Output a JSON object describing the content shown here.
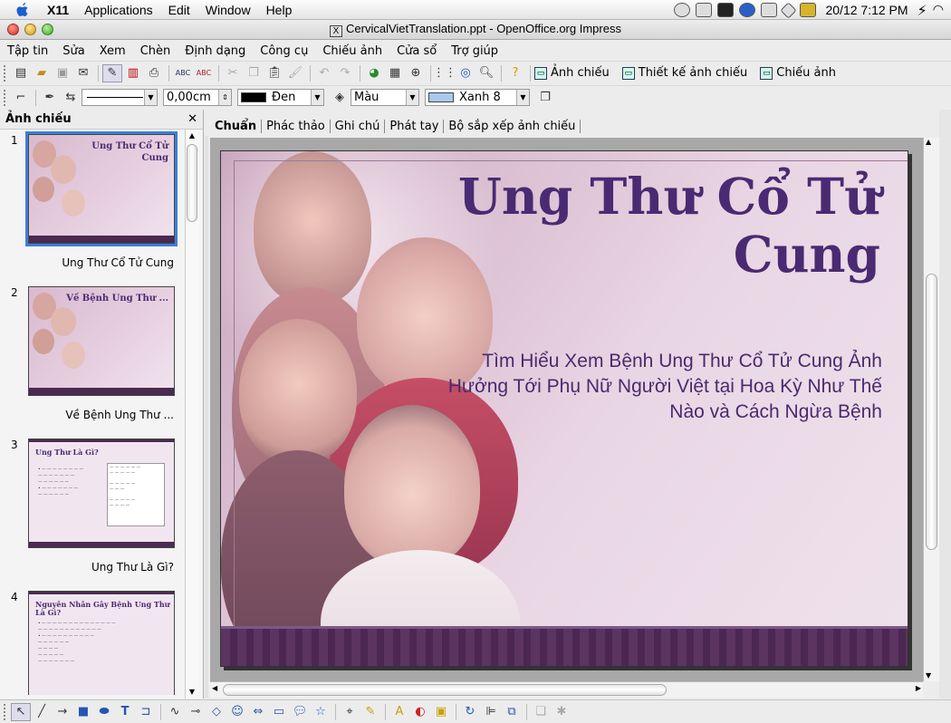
{
  "mac_menubar": {
    "app_name": "X11",
    "menus": [
      "Applications",
      "Edit",
      "Window",
      "Help"
    ],
    "clock": "20/12  7:12 PM"
  },
  "window": {
    "title": "CervicalVietTranslation.ppt - OpenOffice.org Impress"
  },
  "menubar": [
    "Tập tin",
    "Sửa",
    "Xem",
    "Chèn",
    "Định dạng",
    "Công cụ",
    "Chiếu ảnh",
    "Cửa sổ",
    "Trợ giúp"
  ],
  "toolbar1": {
    "slide_show_label": "Ảnh chiếu",
    "slide_design_label": "Thiết kế ảnh chiếu",
    "presentation_label": "Chiếu ảnh"
  },
  "toolbar2": {
    "line_width": "0,00cm",
    "line_color": "Đen",
    "area_style": "Màu",
    "area_color": "Xanh 8"
  },
  "slide_panel": {
    "title": "Ảnh chiếu",
    "slides": [
      {
        "num": "1",
        "caption": "Ung Thư Cổ Tử Cung"
      },
      {
        "num": "2",
        "caption": "Về Bệnh Ung Thư ..."
      },
      {
        "num": "3",
        "caption": "Ung Thư Là Gì?"
      },
      {
        "num": "4",
        "caption": ""
      }
    ],
    "thumb1": {
      "title": "Ung Thư Cổ Tử Cung"
    },
    "thumb2": {
      "title": "Về Bệnh Ung Thư ..."
    },
    "thumb3": {
      "title": "Ung Thư Là Gì?"
    },
    "thumb4": {
      "title": "Nguyên Nhân Gây Bệnh Ung Thư Là Gì?"
    }
  },
  "view_tabs": [
    "Chuẩn",
    "Phác thảo",
    "Ghi chú",
    "Phát tay",
    "Bộ sắp xếp ảnh chiếu"
  ],
  "slide": {
    "title": "Ung Thư Cổ Tử Cung",
    "subtitle": "Tìm Hiểu Xem Bệnh Ung Thư Cổ Tử Cung Ảnh Hưởng Tới Phụ Nữ Người Việt tại Hoa Kỳ Như Thế Nào và Cách Ngừa Bệnh"
  },
  "colors": {
    "title_purple": "#4a2a72",
    "band_purple": "#4b2752",
    "selection_blue": "#3c7fd6"
  }
}
